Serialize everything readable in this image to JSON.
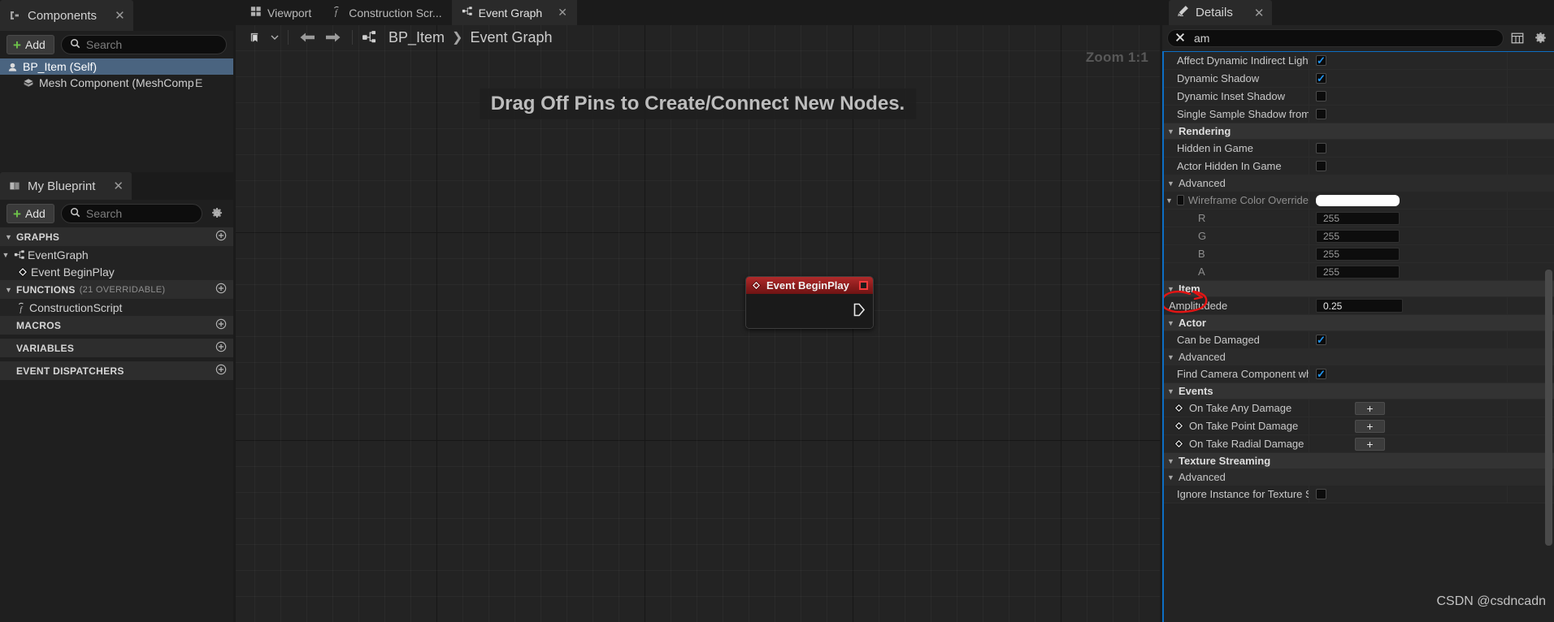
{
  "components_panel": {
    "tab_label": "Components",
    "tab_icon": "components-icon",
    "close_label": "✕",
    "add_label": "Add",
    "search_placeholder": "Search",
    "tree": [
      {
        "label": "BP_Item (Self)",
        "icon": "actor-icon",
        "selected": true,
        "indent": 0
      },
      {
        "label": "Mesh Component (MeshComponent)",
        "icon": "mesh-icon",
        "selected": false,
        "indent": 1,
        "suffix": "E"
      }
    ]
  },
  "myblueprint_panel": {
    "tab_label": "My Blueprint",
    "tab_icon": "blueprint-book-icon",
    "close_label": "✕",
    "add_label": "Add",
    "search_placeholder": "Search",
    "sections": [
      {
        "title": "GRAPHS",
        "subtitle": "",
        "has_add": true,
        "items": [
          {
            "label": "EventGraph",
            "icon": "graph-icon",
            "caret": true,
            "indent": 0
          },
          {
            "label": "Event BeginPlay",
            "icon": "event-diamond-icon",
            "caret": false,
            "indent": 1
          }
        ]
      },
      {
        "title": "FUNCTIONS",
        "subtitle": "(21 OVERRIDABLE)",
        "has_add": true,
        "items": [
          {
            "label": "ConstructionScript",
            "icon": "function-icon",
            "caret": false,
            "indent": 1
          }
        ]
      },
      {
        "title": "MACROS",
        "subtitle": "",
        "has_add": true,
        "items": []
      },
      {
        "title": "VARIABLES",
        "subtitle": "",
        "has_add": true,
        "items": []
      },
      {
        "title": "EVENT DISPATCHERS",
        "subtitle": "",
        "has_add": true,
        "items": []
      }
    ]
  },
  "graph": {
    "tabs": [
      {
        "label": "Viewport",
        "icon": "viewport-icon",
        "active": false,
        "closable": false
      },
      {
        "label": "Construction Scr...",
        "icon": "function-icon",
        "active": false,
        "closable": false
      },
      {
        "label": "Event Graph",
        "icon": "graph-icon",
        "active": true,
        "closable": true,
        "close_label": "✕"
      }
    ],
    "toolbar": {
      "bookmark_icon": "bookmark-icon",
      "chevron_icon": "chevron-down-icon",
      "back_icon": "arrow-left-icon",
      "forward_icon": "arrow-right-icon",
      "graph_icon": "graph-icon"
    },
    "breadcrumb": {
      "root": "BP_Item",
      "separator": "❯",
      "leaf": "Event Graph"
    },
    "zoom_label": "Zoom 1:1",
    "banner_text": "Drag Off Pins to Create/Connect New Nodes.",
    "node": {
      "title": "Event BeginPlay",
      "title_icon": "event-diamond-icon",
      "breakpoint_icon": "red-square-icon",
      "exec_pin_icon": "exec-pin-icon",
      "header_color": "#8b1c1c"
    }
  },
  "details_panel": {
    "tab_label": "Details",
    "tab_icon": "details-pencil-icon",
    "close_label": "✕",
    "search_value": "am",
    "search_clear_icon": "x-icon",
    "column_button_icon": "grid-columns-icon",
    "settings_icon": "gear-icon",
    "accent_color": "#0d6ec4",
    "rows": [
      {
        "kind": "prop",
        "label": "Affect Dynamic Indirect Lighti...",
        "control": "checkbox",
        "checked": true,
        "indent": 1
      },
      {
        "kind": "prop",
        "label": "Dynamic Shadow",
        "control": "checkbox",
        "checked": true,
        "indent": 1
      },
      {
        "kind": "prop",
        "label": "Dynamic Inset Shadow",
        "control": "checkbox",
        "checked": false,
        "indent": 1
      },
      {
        "kind": "prop",
        "label": "Single Sample Shadow from S...",
        "control": "checkbox",
        "checked": false,
        "indent": 1
      },
      {
        "kind": "cat",
        "label": "Rendering",
        "style": "main"
      },
      {
        "kind": "prop",
        "label": "Hidden in Game",
        "control": "checkbox",
        "checked": false,
        "indent": 1
      },
      {
        "kind": "prop",
        "label": "Actor Hidden In Game",
        "control": "checkbox",
        "checked": false,
        "indent": 1
      },
      {
        "kind": "cat",
        "label": "Advanced",
        "style": "sub"
      },
      {
        "kind": "prop",
        "label": "Wireframe Color Override",
        "control": "color",
        "color_value": "#ffffff",
        "dim": true,
        "indent": 0,
        "caret": true,
        "leading_checkbox": false
      },
      {
        "kind": "prop",
        "label": "R",
        "control": "number",
        "value": "255",
        "dim": true,
        "indent": 2
      },
      {
        "kind": "prop",
        "label": "G",
        "control": "number",
        "value": "255",
        "dim": true,
        "indent": 2
      },
      {
        "kind": "prop",
        "label": "B",
        "control": "number",
        "value": "255",
        "dim": true,
        "indent": 2
      },
      {
        "kind": "prop",
        "label": "A",
        "control": "number",
        "value": "255",
        "dim": true,
        "indent": 2
      },
      {
        "kind": "cat",
        "label": "Item",
        "style": "main"
      },
      {
        "kind": "prop",
        "label": "Amplitudede",
        "control": "number-bright",
        "value": "0.25",
        "indent": 1,
        "annotated": true
      },
      {
        "kind": "cat",
        "label": "Actor",
        "style": "main"
      },
      {
        "kind": "prop",
        "label": "Can be Damaged",
        "control": "checkbox",
        "checked": true,
        "indent": 1
      },
      {
        "kind": "cat",
        "label": "Advanced",
        "style": "sub"
      },
      {
        "kind": "prop",
        "label": "Find Camera Component when...",
        "control": "checkbox",
        "checked": true,
        "indent": 1
      },
      {
        "kind": "cat",
        "label": "Events",
        "style": "main"
      },
      {
        "kind": "prop",
        "label": "On Take Any Damage",
        "control": "plus",
        "plus_label": "+",
        "icon": "event-diamond-icon",
        "indent": 1
      },
      {
        "kind": "prop",
        "label": "On Take Point Damage",
        "control": "plus",
        "plus_label": "+",
        "icon": "event-diamond-icon",
        "indent": 1
      },
      {
        "kind": "prop",
        "label": "On Take Radial Damage",
        "control": "plus",
        "plus_label": "+",
        "icon": "event-diamond-icon",
        "indent": 1
      },
      {
        "kind": "cat",
        "label": "Texture Streaming",
        "style": "main"
      },
      {
        "kind": "cat",
        "label": "Advanced",
        "style": "sub"
      },
      {
        "kind": "prop",
        "label": "Ignore Instance for Texture St...",
        "control": "checkbox",
        "checked": false,
        "indent": 1
      }
    ]
  },
  "watermark": {
    "text": "CSDN @csdncadn"
  }
}
